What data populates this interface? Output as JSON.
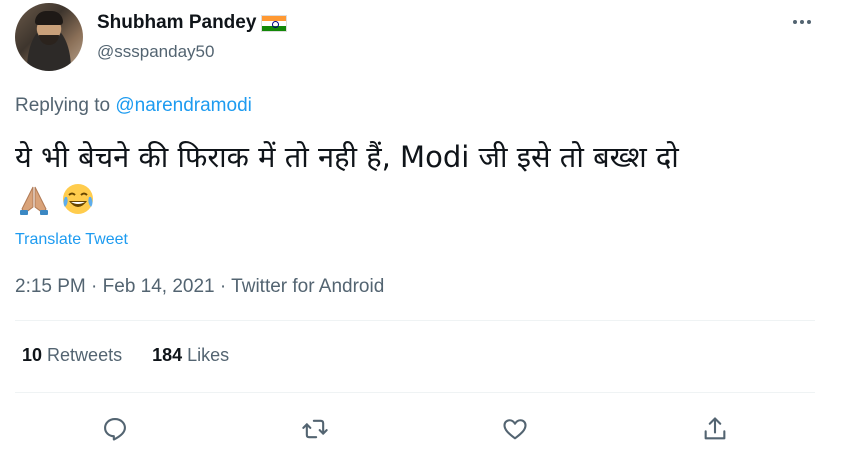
{
  "author": {
    "name": "Shubham Pandey",
    "handle": "@ssspanday50"
  },
  "reply": {
    "prefix": "Replying to",
    "to": "@narendramodi"
  },
  "tweet": {
    "text": "ये भी बेचने की फिराक में तो नही हैं, Modi जी इसे तो बख्श दो",
    "emojis": [
      "folded-hands-icon",
      "tears-of-joy-icon"
    ]
  },
  "translate_label": "Translate Tweet",
  "meta": {
    "time": "2:15 PM",
    "separator": "·",
    "date": "Feb 14, 2021",
    "source": "Twitter for Android",
    "full": "2:15 PM · Feb 14, 2021 · Twitter for Android"
  },
  "stats": {
    "retweets_count": "10",
    "retweets_label": "Retweets",
    "likes_count": "184",
    "likes_label": "Likes"
  },
  "colors": {
    "accent": "#1d9bf0",
    "secondary_text": "#536471",
    "primary_text": "#0f1419",
    "divider": "#eff3f4"
  },
  "actions": [
    "reply-icon",
    "retweet-icon",
    "like-icon",
    "share-icon"
  ]
}
